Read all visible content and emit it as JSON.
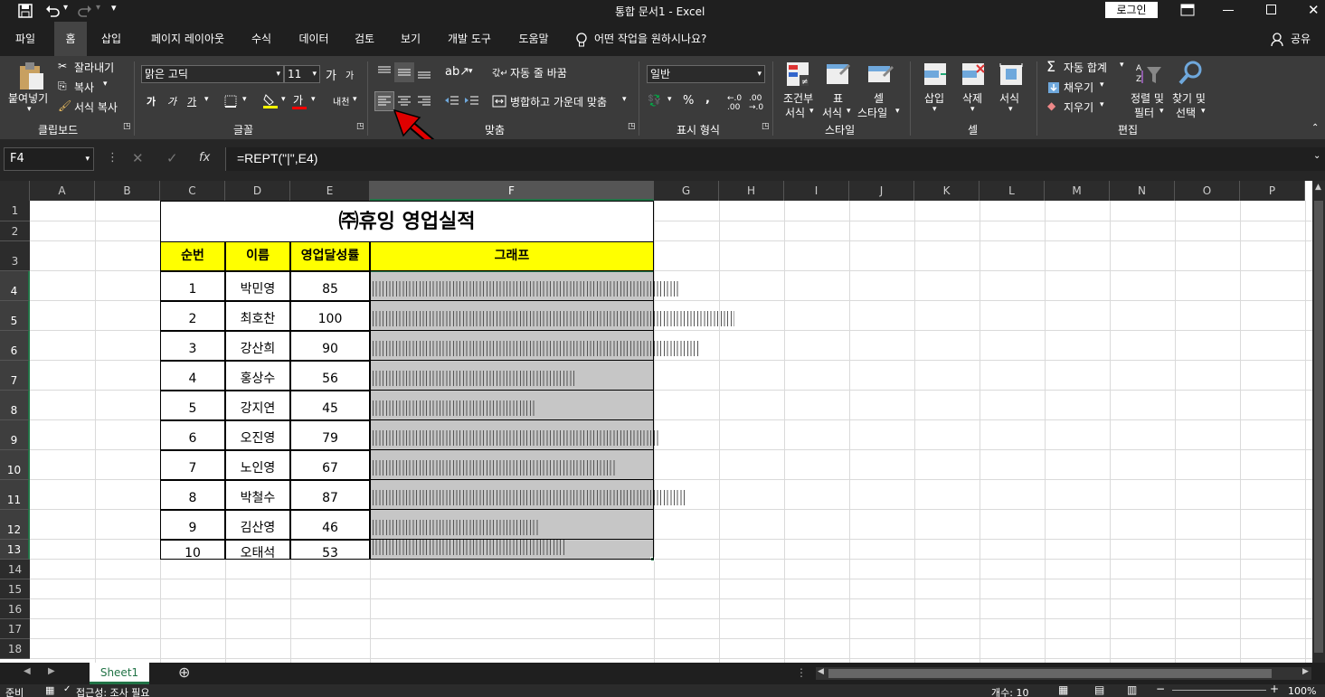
{
  "window": {
    "title": "통합 문서1  -  Excel",
    "login": "로그인"
  },
  "tabs": [
    "파일",
    "홈",
    "삽입",
    "페이지 레이아웃",
    "수식",
    "데이터",
    "검토",
    "보기",
    "개발 도구",
    "도움말"
  ],
  "tell_me": "어떤 작업을 원하시나요?",
  "share": "공유",
  "ribbon": {
    "clipboard": {
      "paste": "붙여넣기",
      "cut": "잘라내기",
      "copy": "복사",
      "format_painter": "서식 복사",
      "group": "클립보드"
    },
    "font": {
      "name": "맑은 고딕",
      "size": "11",
      "group": "글꼴",
      "bold": "가",
      "italic": "가",
      "underline": "가",
      "grow": "가",
      "shrink": "가",
      "font_color": "가",
      "phonetic": "내천"
    },
    "alignment": {
      "wrap": "자동 줄 바꿈",
      "merge": "병합하고 가운데 맞춤",
      "group": "맞춤"
    },
    "number": {
      "format": "일반",
      "percent": "%",
      "comma": ",",
      "group": "표시 형식"
    },
    "styles": {
      "conditional": [
        "조건부",
        "서식"
      ],
      "table": [
        "표",
        "서식"
      ],
      "cell": [
        "셀",
        "스타일"
      ],
      "group": "스타일"
    },
    "cells": {
      "insert": "삽입",
      "delete": "삭제",
      "format": "서식",
      "group": "셀"
    },
    "editing": {
      "autosum": "자동 합계",
      "fill": "채우기",
      "clear": "지우기",
      "sort": [
        "정렬 및",
        "필터"
      ],
      "find": [
        "찾기 및",
        "선택"
      ],
      "group": "편집"
    }
  },
  "formula_bar": {
    "name_box": "F4",
    "fx": "fx",
    "formula": "=REPT(\"|\",E4)"
  },
  "columns": [
    "A",
    "B",
    "C",
    "D",
    "E",
    "F",
    "G",
    "H",
    "I",
    "J",
    "K",
    "L",
    "M",
    "N",
    "O",
    "P"
  ],
  "rows": [
    "1",
    "2",
    "3",
    "4",
    "5",
    "6",
    "7",
    "8",
    "9",
    "10",
    "11",
    "12",
    "13",
    "14",
    "15",
    "16",
    "17",
    "18"
  ],
  "sheet": {
    "title": "㈜휴잉 영업실적",
    "headers": [
      "순번",
      "이름",
      "영업달성률",
      "그래프"
    ],
    "records": [
      {
        "no": "1",
        "name": "박민영",
        "rate": 85
      },
      {
        "no": "2",
        "name": "최호찬",
        "rate": 100
      },
      {
        "no": "3",
        "name": "강산희",
        "rate": 90
      },
      {
        "no": "4",
        "name": "홍상수",
        "rate": 56
      },
      {
        "no": "5",
        "name": "강지연",
        "rate": 45
      },
      {
        "no": "6",
        "name": "오진영",
        "rate": 79
      },
      {
        "no": "7",
        "name": "노인영",
        "rate": 67
      },
      {
        "no": "8",
        "name": "박철수",
        "rate": 87
      },
      {
        "no": "9",
        "name": "김산영",
        "rate": 46
      },
      {
        "no": "10",
        "name": "오태석",
        "rate": 53
      }
    ]
  },
  "sheet_tab": "Sheet1",
  "status": {
    "ready": "준비",
    "accessibility": "접근성: 조사 필요",
    "count": "개수: 10",
    "zoom": "100%"
  },
  "colors": {
    "header_fill": "#ffff00",
    "selection_fill": "#c6c6c6",
    "accent": "#217346",
    "arrow": "#e00000"
  }
}
